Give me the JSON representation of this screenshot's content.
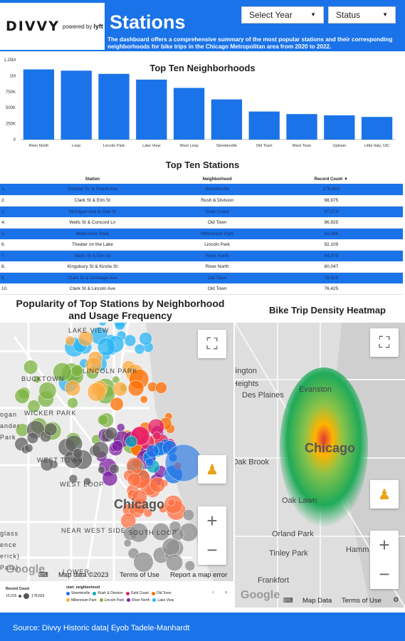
{
  "header": {
    "logo_text": "DIVVY",
    "logo_powered": "powered by",
    "logo_lyft": "lyft",
    "title": "Stations",
    "description": "The dashboard offers a comprehensive summary of the most popular stations and their corresponding neighborhoods for bike trips in the Chicago Metropolitan area from 2020 to 2022.",
    "year_select": "Select Year",
    "status_select": "Status",
    "accent_color": "#1a73e8"
  },
  "chart_data": {
    "type": "bar",
    "title": "Top Ten Neighborhoods",
    "categories": [
      "River North",
      "Loop",
      "Lincoln Park",
      "Lake View",
      "West Loop",
      "Streeterville",
      "Old Town",
      "West Town",
      "Uptown",
      "Little Italy, UIC"
    ],
    "values": [
      1100000,
      1080000,
      1030000,
      940000,
      810000,
      630000,
      440000,
      400000,
      380000,
      355000
    ],
    "ytick_labels": [
      "0",
      "250K",
      "500K",
      "750K",
      "1M",
      "1.25M"
    ],
    "ylim": [
      0,
      1250000
    ],
    "color": "#1a73e8"
  },
  "table": {
    "title": "Top Ten Stations",
    "headers": {
      "station": "Station",
      "neighborhood": "Neighborhood",
      "count": "Record Count ▼"
    },
    "rows": [
      {
        "idx": "1.",
        "station": "Streeter Dr & Grand Ave",
        "neighborhood": "Streeterville",
        "count": "178,603"
      },
      {
        "idx": "2.",
        "station": "Clark St & Elm St",
        "neighborhood": "Rush & Division",
        "count": "98,975"
      },
      {
        "idx": "3.",
        "station": "Michigan Ave & Oak St",
        "neighborhood": "Gold Coast",
        "count": "97,274"
      },
      {
        "idx": "4.",
        "station": "Wells St & Concord Ln",
        "neighborhood": "Old Town",
        "count": "96,925"
      },
      {
        "idx": "5.",
        "station": "Millennium Park",
        "neighborhood": "Millennium Park",
        "count": "92,586"
      },
      {
        "idx": "6.",
        "station": "Theater on the Lake",
        "neighborhood": "Lincoln Park",
        "count": "92,109"
      },
      {
        "idx": "7.",
        "station": "Wells St & Elm St",
        "neighborhood": "River North",
        "count": "84,079"
      },
      {
        "idx": "8.",
        "station": "Kingsbury St & Kinzie St",
        "neighborhood": "River North",
        "count": "80,047"
      },
      {
        "idx": "9.",
        "station": "Clark St & Armitage Ave",
        "neighborhood": "Old Town",
        "count": "78,509"
      },
      {
        "idx": "10.",
        "station": "Clark St & Lincoln Ave",
        "neighborhood": "Old Town",
        "count": "76,425"
      }
    ]
  },
  "map_left": {
    "title": "Popularity of Top Stations by Neighborhood and Usage Frequency",
    "labels": [
      "LAKE VIEW",
      "BUCKTOWN",
      "LINCOLN PARK",
      "WICKER PARK",
      "WEST TOWN",
      "WEST LOOP",
      "NEAR WEST SIDE",
      "SOUTH LOOP",
      "Chicago",
      "LOWER"
    ],
    "edge_labels": [
      "ogan",
      "ander",
      "Park",
      "glass",
      "ence",
      "erick)",
      "Park)"
    ],
    "map_data": "Map data ©2023",
    "terms": "Terms of Use",
    "report": "Report a map error",
    "google": "Google"
  },
  "legend": {
    "size_title": "Record Count",
    "size_min": "10,015",
    "size_max": "178,603",
    "color_title": "start_neighborhood",
    "items": [
      {
        "label": "Streeterville",
        "color": "#1a73e8"
      },
      {
        "label": "Rush & Division",
        "color": "#00acc1"
      },
      {
        "label": "Gold Coast",
        "color": "#e91e63"
      },
      {
        "label": "Old Town",
        "color": "#ff6d00"
      },
      {
        "label": "Millennium Park",
        "color": "#ffab40"
      },
      {
        "label": "Lincoln Park",
        "color": "#7cb342"
      },
      {
        "label": "River North",
        "color": "#7b1fa2"
      },
      {
        "label": "Lake View",
        "color": "#29b6f6"
      }
    ]
  },
  "map_right": {
    "title": "Bike Trip Density Heatmap",
    "labels": [
      "llington",
      "Heights",
      "Des Plaines",
      "Evanston",
      "Chicago",
      "Oak Brook",
      "Oak Lawn",
      "Orland Park",
      "Tinley Park",
      "Hamm",
      "Frankfort"
    ],
    "map_data": "Map Data",
    "terms": "Terms of Use",
    "google": "Google"
  },
  "footer": {
    "text": "Source: Divvy Historic data| Eyob Tadele-Manhardt"
  }
}
